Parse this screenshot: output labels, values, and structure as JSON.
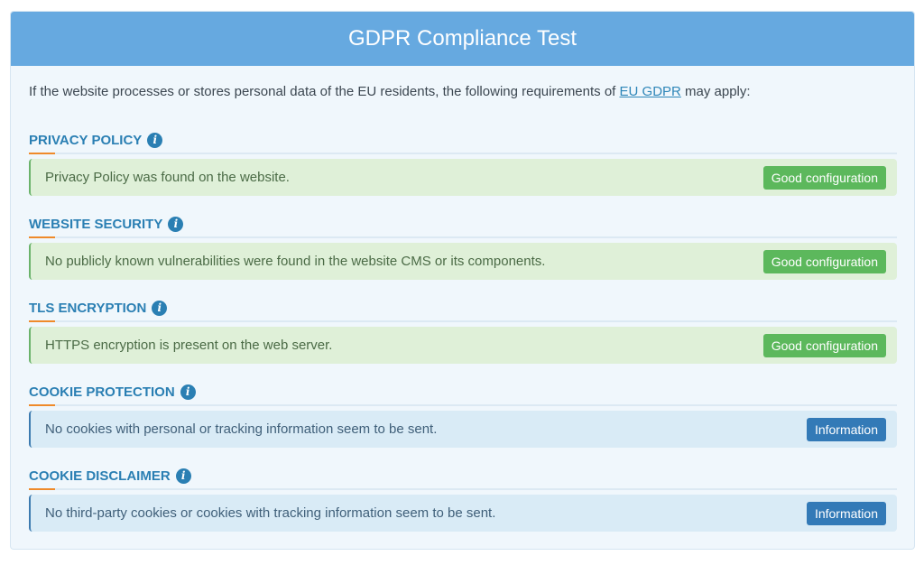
{
  "header": {
    "title": "GDPR Compliance Test"
  },
  "intro": {
    "before": "If the website processes or stores personal data of the EU residents, the following requirements of ",
    "link": "EU GDPR",
    "after": " may apply:"
  },
  "sections": [
    {
      "title": "PRIVACY POLICY",
      "message": "Privacy Policy was found on the website.",
      "badge": "Good configuration",
      "status": "good"
    },
    {
      "title": "WEBSITE SECURITY",
      "message": "No publicly known vulnerabilities were found in the website CMS or its components.",
      "badge": "Good configuration",
      "status": "good"
    },
    {
      "title": "TLS ENCRYPTION",
      "message": "HTTPS encryption is present on the web server.",
      "badge": "Good configuration",
      "status": "good"
    },
    {
      "title": "COOKIE PROTECTION",
      "message": "No cookies with personal or tracking information seem to be sent.",
      "badge": "Information",
      "status": "info"
    },
    {
      "title": "COOKIE DISCLAIMER",
      "message": "No third-party cookies or cookies with tracking information seem to be sent.",
      "badge": "Information",
      "status": "info"
    }
  ],
  "icons": {
    "info": "i"
  },
  "colors": {
    "header": "#66a9e0",
    "good_badge": "#5cb85c",
    "info_badge": "#337ab7",
    "accent": "#ef8a2a"
  }
}
